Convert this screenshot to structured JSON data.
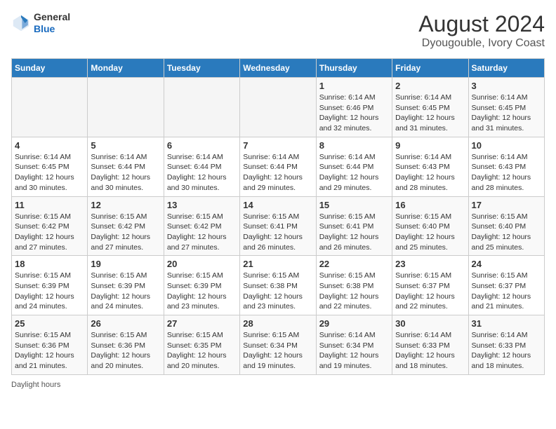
{
  "header": {
    "logo_general": "General",
    "logo_blue": "Blue",
    "month_year": "August 2024",
    "location": "Dyougouble, Ivory Coast"
  },
  "days_of_week": [
    "Sunday",
    "Monday",
    "Tuesday",
    "Wednesday",
    "Thursday",
    "Friday",
    "Saturday"
  ],
  "weeks": [
    [
      {
        "day": "",
        "info": ""
      },
      {
        "day": "",
        "info": ""
      },
      {
        "day": "",
        "info": ""
      },
      {
        "day": "",
        "info": ""
      },
      {
        "day": "1",
        "info": "Sunrise: 6:14 AM\nSunset: 6:46 PM\nDaylight: 12 hours\nand 32 minutes."
      },
      {
        "day": "2",
        "info": "Sunrise: 6:14 AM\nSunset: 6:45 PM\nDaylight: 12 hours\nand 31 minutes."
      },
      {
        "day": "3",
        "info": "Sunrise: 6:14 AM\nSunset: 6:45 PM\nDaylight: 12 hours\nand 31 minutes."
      }
    ],
    [
      {
        "day": "4",
        "info": "Sunrise: 6:14 AM\nSunset: 6:45 PM\nDaylight: 12 hours\nand 30 minutes."
      },
      {
        "day": "5",
        "info": "Sunrise: 6:14 AM\nSunset: 6:44 PM\nDaylight: 12 hours\nand 30 minutes."
      },
      {
        "day": "6",
        "info": "Sunrise: 6:14 AM\nSunset: 6:44 PM\nDaylight: 12 hours\nand 30 minutes."
      },
      {
        "day": "7",
        "info": "Sunrise: 6:14 AM\nSunset: 6:44 PM\nDaylight: 12 hours\nand 29 minutes."
      },
      {
        "day": "8",
        "info": "Sunrise: 6:14 AM\nSunset: 6:44 PM\nDaylight: 12 hours\nand 29 minutes."
      },
      {
        "day": "9",
        "info": "Sunrise: 6:14 AM\nSunset: 6:43 PM\nDaylight: 12 hours\nand 28 minutes."
      },
      {
        "day": "10",
        "info": "Sunrise: 6:14 AM\nSunset: 6:43 PM\nDaylight: 12 hours\nand 28 minutes."
      }
    ],
    [
      {
        "day": "11",
        "info": "Sunrise: 6:15 AM\nSunset: 6:42 PM\nDaylight: 12 hours\nand 27 minutes."
      },
      {
        "day": "12",
        "info": "Sunrise: 6:15 AM\nSunset: 6:42 PM\nDaylight: 12 hours\nand 27 minutes."
      },
      {
        "day": "13",
        "info": "Sunrise: 6:15 AM\nSunset: 6:42 PM\nDaylight: 12 hours\nand 27 minutes."
      },
      {
        "day": "14",
        "info": "Sunrise: 6:15 AM\nSunset: 6:41 PM\nDaylight: 12 hours\nand 26 minutes."
      },
      {
        "day": "15",
        "info": "Sunrise: 6:15 AM\nSunset: 6:41 PM\nDaylight: 12 hours\nand 26 minutes."
      },
      {
        "day": "16",
        "info": "Sunrise: 6:15 AM\nSunset: 6:40 PM\nDaylight: 12 hours\nand 25 minutes."
      },
      {
        "day": "17",
        "info": "Sunrise: 6:15 AM\nSunset: 6:40 PM\nDaylight: 12 hours\nand 25 minutes."
      }
    ],
    [
      {
        "day": "18",
        "info": "Sunrise: 6:15 AM\nSunset: 6:39 PM\nDaylight: 12 hours\nand 24 minutes."
      },
      {
        "day": "19",
        "info": "Sunrise: 6:15 AM\nSunset: 6:39 PM\nDaylight: 12 hours\nand 24 minutes."
      },
      {
        "day": "20",
        "info": "Sunrise: 6:15 AM\nSunset: 6:39 PM\nDaylight: 12 hours\nand 23 minutes."
      },
      {
        "day": "21",
        "info": "Sunrise: 6:15 AM\nSunset: 6:38 PM\nDaylight: 12 hours\nand 23 minutes."
      },
      {
        "day": "22",
        "info": "Sunrise: 6:15 AM\nSunset: 6:38 PM\nDaylight: 12 hours\nand 22 minutes."
      },
      {
        "day": "23",
        "info": "Sunrise: 6:15 AM\nSunset: 6:37 PM\nDaylight: 12 hours\nand 22 minutes."
      },
      {
        "day": "24",
        "info": "Sunrise: 6:15 AM\nSunset: 6:37 PM\nDaylight: 12 hours\nand 21 minutes."
      }
    ],
    [
      {
        "day": "25",
        "info": "Sunrise: 6:15 AM\nSunset: 6:36 PM\nDaylight: 12 hours\nand 21 minutes."
      },
      {
        "day": "26",
        "info": "Sunrise: 6:15 AM\nSunset: 6:36 PM\nDaylight: 12 hours\nand 20 minutes."
      },
      {
        "day": "27",
        "info": "Sunrise: 6:15 AM\nSunset: 6:35 PM\nDaylight: 12 hours\nand 20 minutes."
      },
      {
        "day": "28",
        "info": "Sunrise: 6:15 AM\nSunset: 6:34 PM\nDaylight: 12 hours\nand 19 minutes."
      },
      {
        "day": "29",
        "info": "Sunrise: 6:14 AM\nSunset: 6:34 PM\nDaylight: 12 hours\nand 19 minutes."
      },
      {
        "day": "30",
        "info": "Sunrise: 6:14 AM\nSunset: 6:33 PM\nDaylight: 12 hours\nand 18 minutes."
      },
      {
        "day": "31",
        "info": "Sunrise: 6:14 AM\nSunset: 6:33 PM\nDaylight: 12 hours\nand 18 minutes."
      }
    ]
  ],
  "footer": {
    "note": "Daylight hours"
  }
}
